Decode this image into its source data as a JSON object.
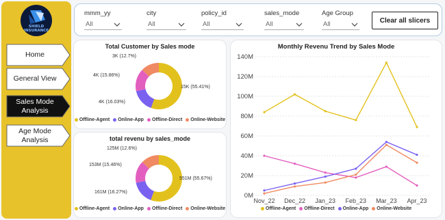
{
  "logo": {
    "line1": "SHIELD",
    "line2": "INSURANCE"
  },
  "nav": [
    {
      "label": "Home"
    },
    {
      "label": "General View"
    },
    {
      "label": "Sales Mode Analysis",
      "active": true
    },
    {
      "label": "Age Mode Analysis"
    }
  ],
  "slicers": [
    {
      "title": "mmm_yy",
      "value": "All"
    },
    {
      "title": "city",
      "value": "All"
    },
    {
      "title": "policy_id",
      "value": "All"
    },
    {
      "title": "sales_mode",
      "value": "All"
    },
    {
      "title": "Age Group",
      "value": "All"
    }
  ],
  "clear_button": "Clear all slicers",
  "colors": {
    "Offline-Agent": "#e3c11d",
    "Online-App": "#7b61f0",
    "Offline-Direct": "#e35fbf",
    "Online-Website": "#ef8a62"
  },
  "legend": [
    "Offline-Agent",
    "Online-App",
    "Offline-Direct",
    "Online-Website"
  ],
  "line_legend": [
    "Offline-Agent",
    "Offline-Direct",
    "Online-App",
    "Online-Website"
  ],
  "chart_data": [
    {
      "type": "pie",
      "title": "Total Customer by Sales mode",
      "slices": [
        {
          "name": "Offline-Agent",
          "value": 55.41,
          "label": "15K (55.41%)"
        },
        {
          "name": "Online-App",
          "value": 16.03,
          "label": "4K (16.03%)"
        },
        {
          "name": "Offline-Direct",
          "value": 15.86,
          "label": "4K (15.86%)"
        },
        {
          "name": "Online-Website",
          "value": 12.7,
          "label": "3K (12.7%)"
        }
      ]
    },
    {
      "type": "pie",
      "title": "total revenu by sales_mode",
      "slices": [
        {
          "name": "Offline-Agent",
          "value": 55.67,
          "label": "551M (55.67%)"
        },
        {
          "name": "Online-App",
          "value": 16.27,
          "label": "161M (16.27%)"
        },
        {
          "name": "Offline-Direct",
          "value": 15.46,
          "label": "153M (15.46%)"
        },
        {
          "name": "Online-Website",
          "value": 12.6,
          "label": "125M (12.6%)"
        }
      ]
    },
    {
      "type": "line",
      "title": "Monthly Revenu Trend by Sales Mode",
      "categories": [
        "Nov_22",
        "Dec_22",
        "Jan_23",
        "Feb_23",
        "Mar_23",
        "Apr_23"
      ],
      "ylim": [
        0,
        140
      ],
      "yticks": [
        "0M",
        "20M",
        "40M",
        "60M",
        "80M",
        "100M",
        "120M",
        "140M"
      ],
      "series": [
        {
          "name": "Offline-Agent",
          "values": [
            84,
            102,
            85,
            76,
            134,
            69
          ]
        },
        {
          "name": "Offline-Direct",
          "values": [
            40,
            32,
            23,
            18,
            29,
            10
          ]
        },
        {
          "name": "Online-App",
          "values": [
            5,
            12,
            19,
            27,
            54,
            41
          ]
        },
        {
          "name": "Online-Website",
          "values": [
            2,
            9,
            13,
            21,
            51,
            33
          ]
        }
      ]
    }
  ]
}
